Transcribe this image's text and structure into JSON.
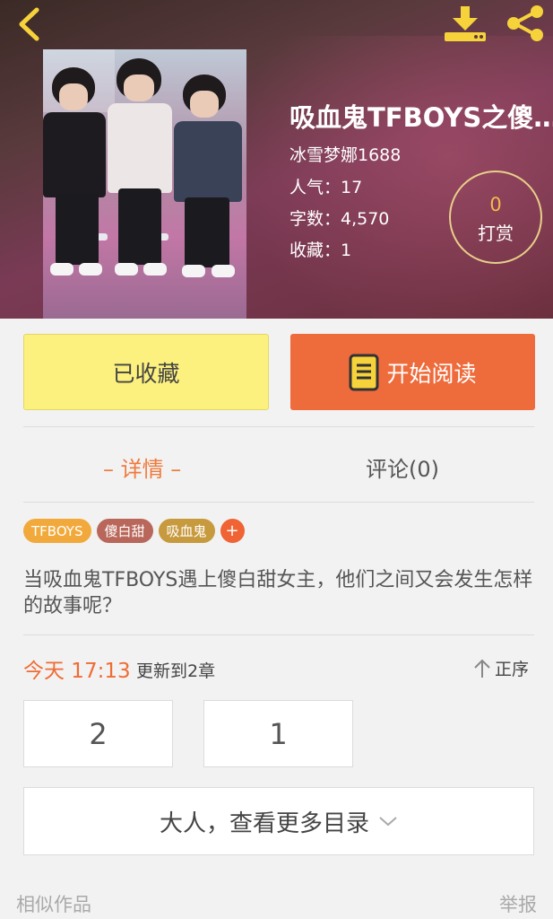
{
  "book": {
    "title": "吸血鬼TFBOYS之傻…",
    "author": "冰雪梦娜1688",
    "popularity": "人气：17",
    "word_count": "字数：4,570",
    "favorites": "收藏：1"
  },
  "reward": {
    "count": "0",
    "label": "打赏"
  },
  "actions": {
    "favorited_label": "已收藏",
    "read_label": "开始阅读"
  },
  "tabs": [
    {
      "label": "– 详情 –",
      "active": true
    },
    {
      "label": "评论(0)",
      "active": false
    }
  ],
  "tags": [
    {
      "label": "TFBOYS",
      "color": "#f2a93b"
    },
    {
      "label": "傻白甜",
      "color": "#b9675a"
    },
    {
      "label": "吸血鬼",
      "color": "#c79a3e"
    }
  ],
  "tag_add_label": "+",
  "description": "当吸血鬼TFBOYS遇上傻白甜女主，他们之间又会发生怎样的故事呢？",
  "update": {
    "time": "今天 17:13",
    "text": "更新到2章",
    "sort_label": "正序"
  },
  "chapters": [
    "2",
    "1"
  ],
  "more_catalog": "大人，查看更多目录",
  "footer": {
    "similar": "相似作品",
    "report": "举报"
  },
  "icons": {
    "back": "chevron-left-icon",
    "download": "download-icon",
    "share": "share-icon",
    "book": "book-icon",
    "sort": "arrow-up-icon",
    "expand": "chevron-down-icon"
  },
  "colors": {
    "accent": "#ee6b3c",
    "favorite_bg": "#fcf17e",
    "icon_yellow": "#f6d33b"
  }
}
